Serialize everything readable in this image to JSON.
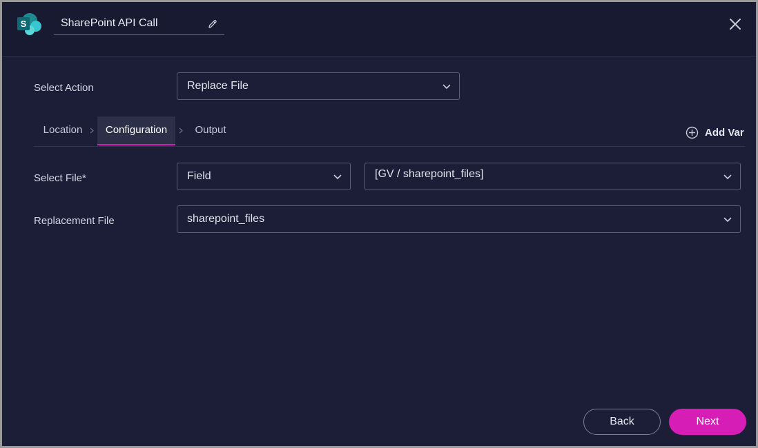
{
  "header": {
    "title": "SharePoint API Call",
    "logo_icon": "sharepoint-logo",
    "edit_icon": "pencil-icon",
    "close_icon": "close-icon"
  },
  "action": {
    "label": "Select Action",
    "value": "Replace File"
  },
  "tabs": [
    {
      "label": "Location"
    },
    {
      "label": "Configuration",
      "active": true
    },
    {
      "label": "Output"
    }
  ],
  "add_var": {
    "label": "Add Var",
    "icon": "plus-circle-icon"
  },
  "select_file": {
    "label": "Select File*",
    "type_value": "Field",
    "field_value": "[GV / sharepoint_files]"
  },
  "replacement_file": {
    "label": "Replacement File",
    "value": "sharepoint_files"
  },
  "footer": {
    "back_label": "Back",
    "next_label": "Next"
  },
  "colors": {
    "background": "#1b1e36",
    "header": "#171a30",
    "accent": "#d61eb7",
    "brand_teal": "#0f7b86"
  }
}
